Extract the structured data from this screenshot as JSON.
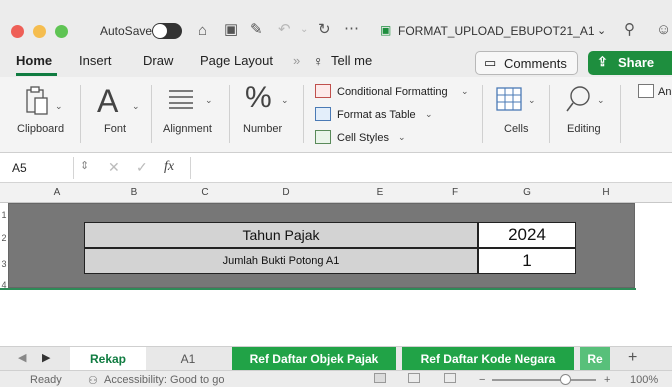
{
  "titlebar": {
    "autosave_label": "AutoSave",
    "filename": "FORMAT_UPLOAD_EBUPOT21_A1",
    "filename_caret": "⌄"
  },
  "ribbon_tabs": {
    "items": [
      "Home",
      "Insert",
      "Draw",
      "Page Layout"
    ],
    "overflow": "»",
    "tell_me": "Tell me",
    "comments_label": "Comments",
    "share_label": "Share"
  },
  "ribbon": {
    "clipboard": "Clipboard",
    "font": "Font",
    "alignment": "Alignment",
    "number": "Number",
    "conditional_formatting": "Conditional Formatting",
    "format_as_table": "Format as Table",
    "cell_styles": "Cell Styles",
    "cells": "Cells",
    "editing": "Editing",
    "analyze_partial": "An",
    "font_glyph": "A",
    "number_glyph": "%"
  },
  "formula_bar": {
    "name_box": "A5",
    "fx": "fx",
    "value": ""
  },
  "grid": {
    "columns": [
      "A",
      "B",
      "C",
      "D",
      "E",
      "F",
      "G",
      "H"
    ],
    "rows": [
      "1",
      "2",
      "3",
      "4"
    ],
    "tahun_pajak_label": "Tahun Pajak",
    "tahun_pajak_value": "2024",
    "jumlah_label": "Jumlah Bukti Potong A1",
    "jumlah_value": "1"
  },
  "sheet_tabs": {
    "items": [
      "Rekap",
      "A1",
      "Ref Daftar Objek Pajak",
      "Ref Daftar Kode Negara",
      "Re"
    ],
    "active": "Rekap",
    "add": "+"
  },
  "statusbar": {
    "ready": "Ready",
    "accessibility": "Accessibility: Good to go",
    "zoom_minus": "−",
    "zoom_plus": "+",
    "zoom": "100%"
  },
  "colors": {
    "accent_green": "#107c41",
    "share_green": "#1e8e3e",
    "sheet_tab_green": "#21a347",
    "grey_block": "#777777",
    "label_cell": "#d3d3d3"
  }
}
